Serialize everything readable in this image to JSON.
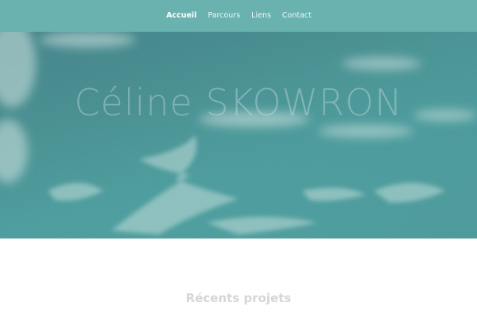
{
  "nav": {
    "items": [
      {
        "label": "Accueil",
        "active": true
      },
      {
        "label": "Parcours",
        "active": false
      },
      {
        "label": "Liens",
        "active": false
      },
      {
        "label": "Contact",
        "active": false
      }
    ]
  },
  "hero": {
    "title": "Céline SKOWRON"
  },
  "section": {
    "title": "Récents projets"
  },
  "colors": {
    "navbar": "#69b2b0",
    "sky": "#46999a",
    "section_title": "#d6d6d6"
  }
}
